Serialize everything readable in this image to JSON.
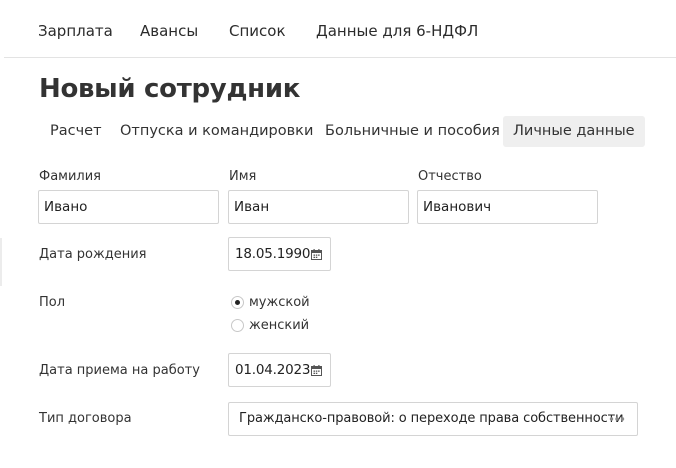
{
  "topnav": {
    "items": [
      {
        "label": "Зарплата"
      },
      {
        "label": "Авансы"
      },
      {
        "label": "Список"
      },
      {
        "label": "Данные для 6-НДФЛ"
      }
    ]
  },
  "page": {
    "title": "Новый сотрудник"
  },
  "subtabs": {
    "items": [
      {
        "label": "Расчет",
        "active": false
      },
      {
        "label": "Отпуска и командировки",
        "active": false
      },
      {
        "label": "Больничные и пособия",
        "active": false
      },
      {
        "label": "Личные данные",
        "active": true
      }
    ]
  },
  "form": {
    "last_name": {
      "label": "Фамилия",
      "value": "Ивано"
    },
    "first_name": {
      "label": "Имя",
      "value": "Иван"
    },
    "middle_name": {
      "label": "Отчество",
      "value": "Иванович"
    },
    "birth_date": {
      "label": "Дата рождения",
      "value": "18.05.1990"
    },
    "gender": {
      "label": "Пол",
      "options": [
        {
          "label": "мужской",
          "checked": true
        },
        {
          "label": "женский",
          "checked": false
        }
      ]
    },
    "hire_date": {
      "label": "Дата приема на работу",
      "value": "01.04.2023"
    },
    "contract_type": {
      "label": "Тип договора",
      "value": "Гражданско-правовой: о переходе права собственности"
    }
  },
  "icons": {
    "date_picker": "calendar-icon",
    "select_more": "more-horizontal-icon"
  },
  "colors": {
    "active_tab_bg": "#efefef",
    "border": "#d4d4d4",
    "text": "#2b2b2b"
  }
}
